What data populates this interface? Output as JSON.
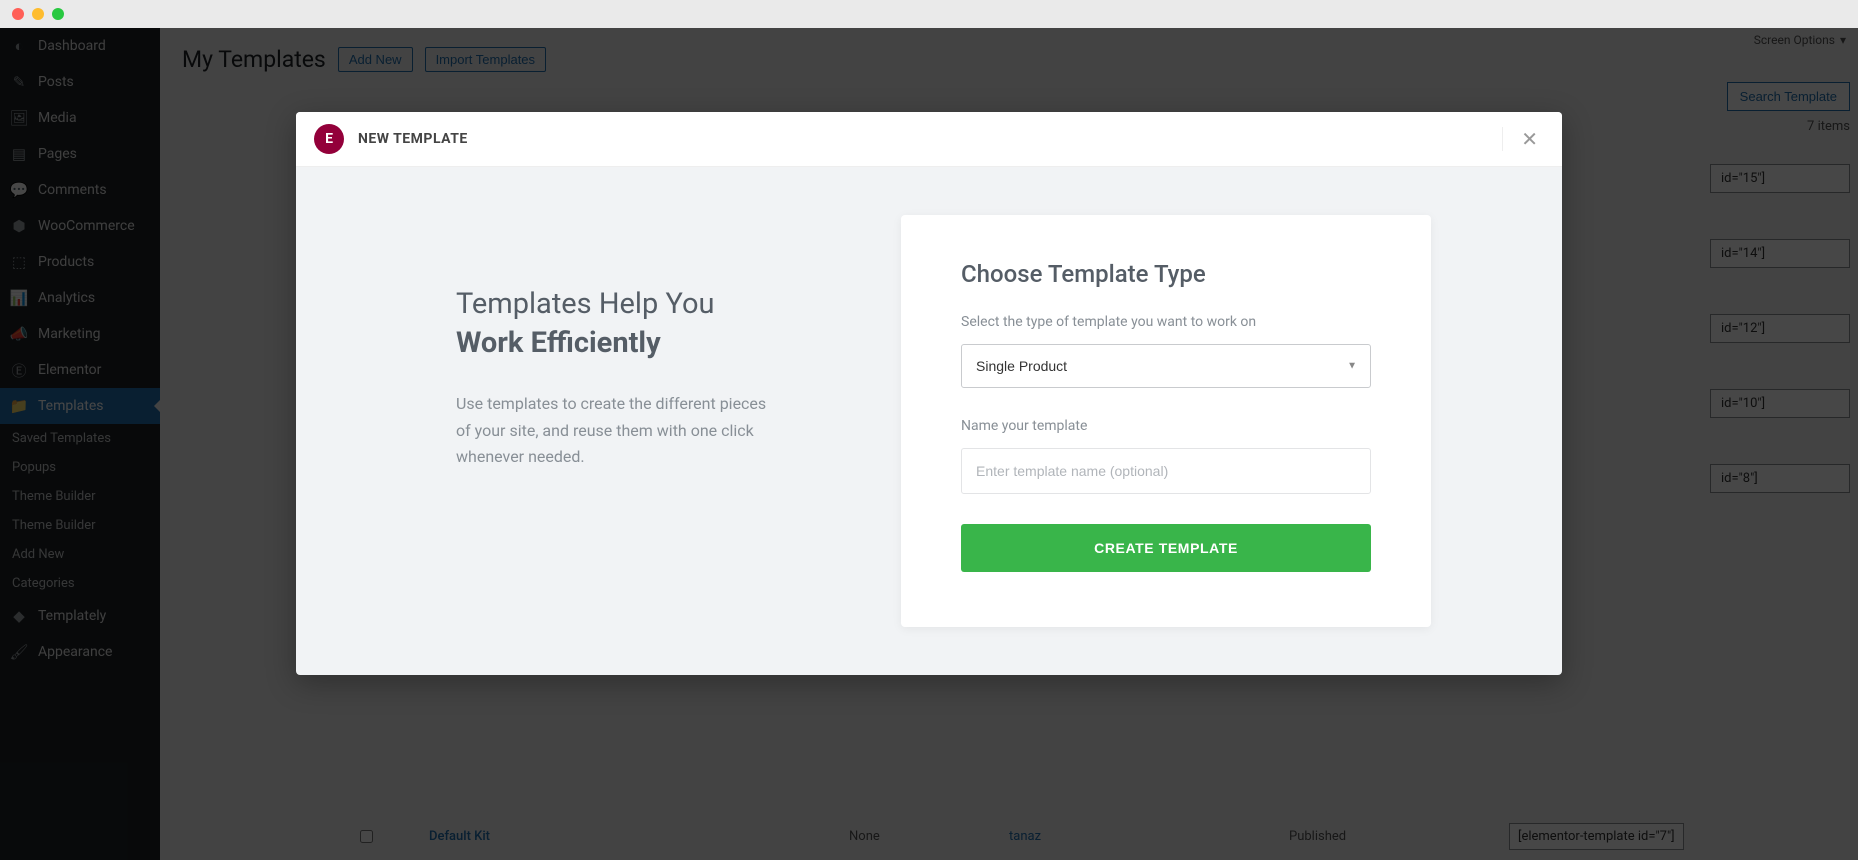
{
  "sidebar": {
    "items": [
      {
        "label": "Dashboard",
        "icon": "gauge"
      },
      {
        "label": "Posts",
        "icon": "pin"
      },
      {
        "label": "Media",
        "icon": "media"
      },
      {
        "label": "Pages",
        "icon": "pages"
      },
      {
        "label": "Comments",
        "icon": "comment"
      },
      {
        "label": "WooCommerce",
        "icon": "woo"
      },
      {
        "label": "Products",
        "icon": "product"
      },
      {
        "label": "Analytics",
        "icon": "chart"
      },
      {
        "label": "Marketing",
        "icon": "megaphone"
      },
      {
        "label": "Elementor",
        "icon": "elementor"
      },
      {
        "label": "Templates",
        "icon": "folder",
        "active": true
      },
      {
        "label": "Templately",
        "icon": "templately"
      },
      {
        "label": "Appearance",
        "icon": "brush"
      }
    ],
    "subs": [
      "Saved Templates",
      "Popups",
      "Theme Builder",
      "Theme Builder",
      "Add New",
      "Categories"
    ]
  },
  "header": {
    "title": "My Templates",
    "add_new": "Add New",
    "import": "Import Templates",
    "screen_options": "Screen Options"
  },
  "search": {
    "button": "Search Template",
    "items_count": "7 items"
  },
  "shortcodes": [
    "id=\"15\"]",
    "id=\"14\"]",
    "id=\"12\"]",
    "id=\"10\"]",
    "id=\"8\"]"
  ],
  "table_row": {
    "title": "Default Kit",
    "type": "None",
    "author": "tanaz",
    "status": "Published",
    "shortcode": "[elementor-template id=\"7\"]"
  },
  "modal": {
    "badge": "E",
    "header": "NEW TEMPLATE",
    "blurb_line1": "Templates Help You",
    "blurb_line2": "Work Efficiently",
    "blurb_p": "Use templates to create the different pieces of your site, and reuse them with one click whenever needed.",
    "form_title": "Choose Template Type",
    "type_label": "Select the type of template you want to work on",
    "type_value": "Single Product",
    "name_label": "Name your template",
    "name_placeholder": "Enter template name (optional)",
    "create_btn": "CREATE TEMPLATE"
  }
}
